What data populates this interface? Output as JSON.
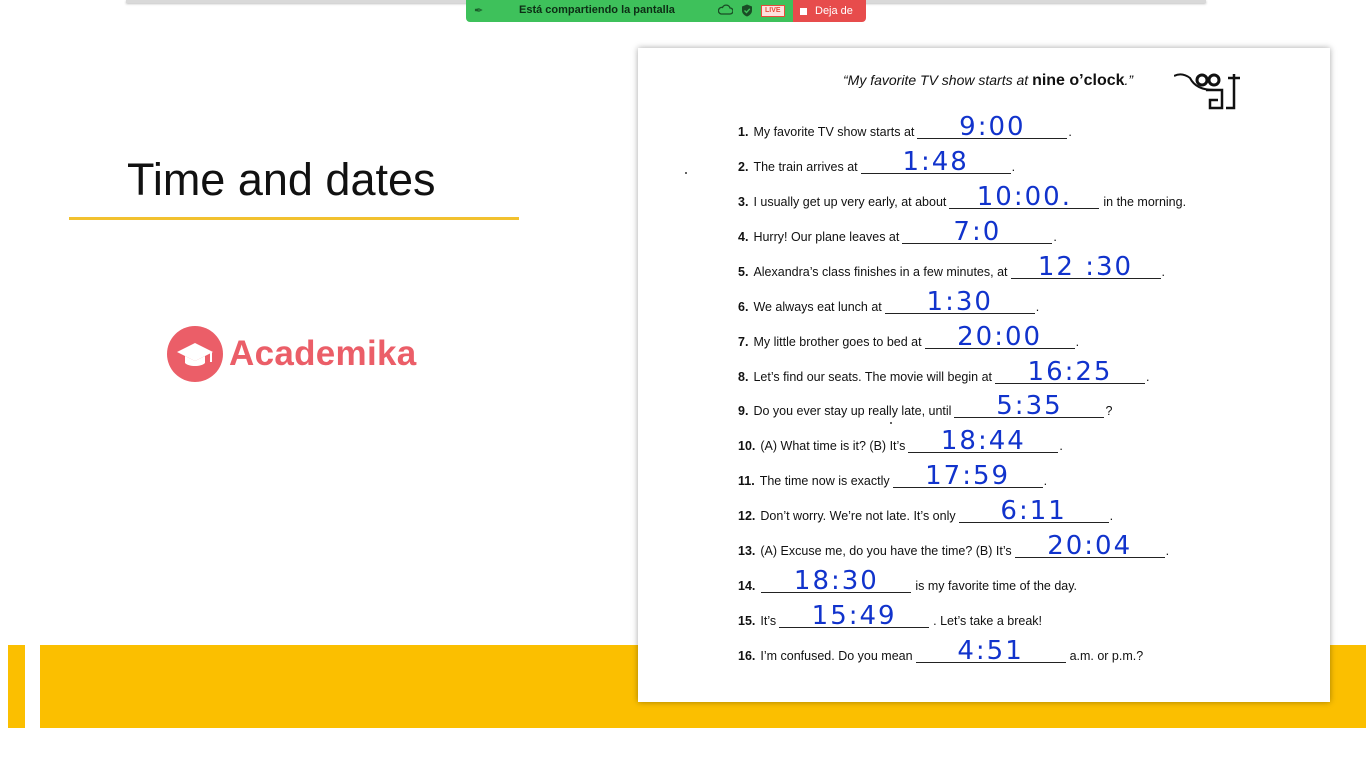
{
  "share_bar": {
    "status_label": "Está compartiendo la pantalla",
    "live_label": "LIVE",
    "leave_label": "Deja de"
  },
  "slide": {
    "title": "Time and dates",
    "logo_text": "Academika"
  },
  "colors": {
    "accent_yellow": "#fbbf00",
    "brand_coral": "#eb5e68",
    "share_green": "#3ec15b",
    "leave_red": "#e74c4c",
    "handwriting_blue": "#1133cc"
  },
  "worksheet": {
    "quote_prefix": "“My favorite TV show starts at ",
    "quote_strong": "nine o’clock",
    "quote_suffix": ".”",
    "items": [
      {
        "num": "1.",
        "before": "My favorite TV show starts at",
        "answer": "9:00",
        "after": "."
      },
      {
        "num": "2.",
        "before": "The train arrives at",
        "answer": "1:48",
        "after": "."
      },
      {
        "num": "3.",
        "before": "I usually get up very early, at about",
        "answer": "10:00.",
        "after": "in the morning."
      },
      {
        "num": "4.",
        "before": "Hurry!  Our plane leaves at",
        "answer": "7:0",
        "after": "."
      },
      {
        "num": "5.",
        "before": "Alexandra’s class finishes in a few minutes, at",
        "answer": "12 :30",
        "after": "."
      },
      {
        "num": "6.",
        "before": "We always eat lunch at",
        "answer": "1:30",
        "after": "."
      },
      {
        "num": "7.",
        "before": "My little brother goes to bed at",
        "answer": "20:00",
        "after": "."
      },
      {
        "num": "8.",
        "before": "Let’s find our seats.  The movie will begin at",
        "answer": "16:25",
        "after": "."
      },
      {
        "num": "9.",
        "before": "Do you ever stay up really late, until",
        "answer": "5:35",
        "after": "?"
      },
      {
        "num": "10.",
        "before": "(A) What time is it?  (B) It’s",
        "answer": "18:44",
        "after": "."
      },
      {
        "num": "11.",
        "before": "The time now is exactly",
        "answer": "17:59",
        "after": "."
      },
      {
        "num": "12.",
        "before": "Don’t worry.  We’re not late.  It’s only",
        "answer": "6:11",
        "after": "."
      },
      {
        "num": "13.",
        "before": "(A) Excuse me, do you have the time?  (B) It’s",
        "answer": "20:04",
        "after": "."
      },
      {
        "num": "14.",
        "before": "",
        "answer": "18:30",
        "after": "is my favorite time of the day."
      },
      {
        "num": "15.",
        "before": "It’s",
        "answer": "15:49",
        "after": ".  Let’s take a break!"
      },
      {
        "num": "16.",
        "before": "I’m confused.  Do you mean",
        "answer": "4:51",
        "after": "a.m. or p.m.?"
      }
    ]
  }
}
